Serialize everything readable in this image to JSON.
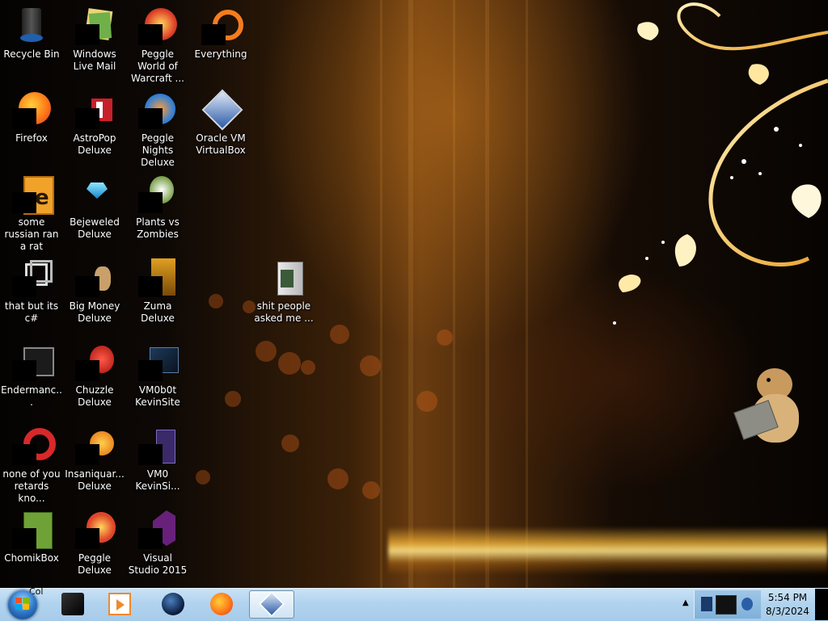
{
  "desktop": {
    "icons": [
      {
        "id": "recycle-bin",
        "label": "Recycle Bin"
      },
      {
        "id": "windows-live-mail",
        "label": "Windows Live Mail"
      },
      {
        "id": "peggle-world-of-warcraft",
        "label": "Peggle World of Warcraft ..."
      },
      {
        "id": "everything",
        "label": "Everything"
      },
      {
        "id": "firefox",
        "label": "Firefox"
      },
      {
        "id": "astropop-deluxe",
        "label": "AstroPop Deluxe"
      },
      {
        "id": "peggle-nights-deluxe",
        "label": "Peggle Nights Deluxe"
      },
      {
        "id": "oracle-vm-virtualbox",
        "label": "Oracle VM VirtualBox"
      },
      {
        "id": "some-russian-ran-a-rat",
        "label": "some russian ran a rat"
      },
      {
        "id": "bejeweled-deluxe",
        "label": "Bejeweled Deluxe"
      },
      {
        "id": "plants-vs-zombies",
        "label": "Plants vs Zombies"
      },
      {
        "id": "that-but-its-csharp",
        "label": "that but its c#"
      },
      {
        "id": "big-money-deluxe",
        "label": "Big Money Deluxe"
      },
      {
        "id": "zuma-deluxe",
        "label": "Zuma Deluxe"
      },
      {
        "id": "shit-people-asked-me",
        "label": "shit people asked me ..."
      },
      {
        "id": "endermanc",
        "label": "Endermanc..."
      },
      {
        "id": "chuzzle-deluxe",
        "label": "Chuzzle Deluxe"
      },
      {
        "id": "vm0b0t-kevinsite",
        "label": "VM0b0t KevinSite"
      },
      {
        "id": "none-of-you-retards-kno",
        "label": "none of you retards kno..."
      },
      {
        "id": "insaniquarium-deluxe",
        "label": "Insaniquar... Deluxe"
      },
      {
        "id": "vm0-kevinsi",
        "label": "VM0 KevinSi..."
      },
      {
        "id": "chomikbox",
        "label": "ChomikBox"
      },
      {
        "id": "peggle-deluxe",
        "label": "Peggle Deluxe"
      },
      {
        "id": "visual-studio-2015",
        "label": "Visual Studio 2015"
      }
    ]
  },
  "taskbar": {
    "start_partial_text": "Col",
    "pinned": [
      {
        "id": "black-app",
        "icon": "black-box-icon"
      },
      {
        "id": "media-player",
        "icon": "media-player-icon"
      },
      {
        "id": "globe-app",
        "icon": "globe-icon"
      },
      {
        "id": "firefox",
        "icon": "firefox-icon"
      },
      {
        "id": "virtualbox",
        "icon": "virtualbox-icon",
        "active": true
      }
    ],
    "tray": {
      "show_hidden_arrow": "▲",
      "time": "5:54 PM",
      "date": "8/3/2024"
    }
  },
  "colors": {
    "taskbar": "#b1d3ee",
    "accent_gold": "#f2b33a"
  }
}
